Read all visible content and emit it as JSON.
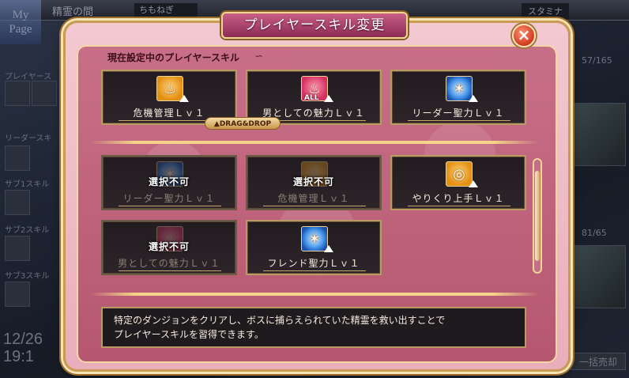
{
  "background": {
    "mypage_label": "My Page",
    "location_title": "精霊の間",
    "player_name": "ちもねぎ",
    "stamina_label": "スタミナ",
    "left_labels": [
      "プレイヤース",
      "リーダースキ",
      "サブ1スキル",
      "サブ2スキル",
      "サブ3スキル"
    ],
    "date": "12/26",
    "time": "19:1",
    "counter_top": "57/165",
    "counter_mid": "81/65",
    "bulk_button": "一括売却"
  },
  "dialog": {
    "title": "プレイヤースキル変更",
    "close_label": "×",
    "current_section_label": "現在設定中のプレイヤースキル",
    "drag_drop_label": "▲DRAG&DROP",
    "lock_label": "選択不可",
    "current_skills": [
      {
        "name": "危機管理Ｌｖ１",
        "icon": "boots-orange-icon"
      },
      {
        "name": "男としての魅力Ｌｖ１",
        "icon": "boots-pink-all-icon",
        "tag": "ALL"
      },
      {
        "name": "リーダー聖力Ｌｖ１",
        "icon": "crystal-blue-icon"
      }
    ],
    "available_skills": [
      {
        "name": "リーダー聖力Ｌｖ１",
        "icon": "crystal-blue-icon",
        "locked": true
      },
      {
        "name": "危機管理Ｌｖ１",
        "icon": "boots-orange-icon",
        "locked": true
      },
      {
        "name": "やりくり上手Ｌｖ１",
        "icon": "coin-orange-icon",
        "locked": false
      },
      {
        "name": "男としての魅力Ｌｖ１",
        "icon": "boots-pink-icon",
        "locked": true
      },
      {
        "name": "フレンド聖力Ｌｖ１",
        "icon": "crystal-blue-icon",
        "locked": false
      }
    ],
    "description_line1": "特定のダンジョンをクリアし、ボスに捕らえられていた精霊を救い出すことで",
    "description_line2": "プレイヤースキルを習得できます。"
  }
}
